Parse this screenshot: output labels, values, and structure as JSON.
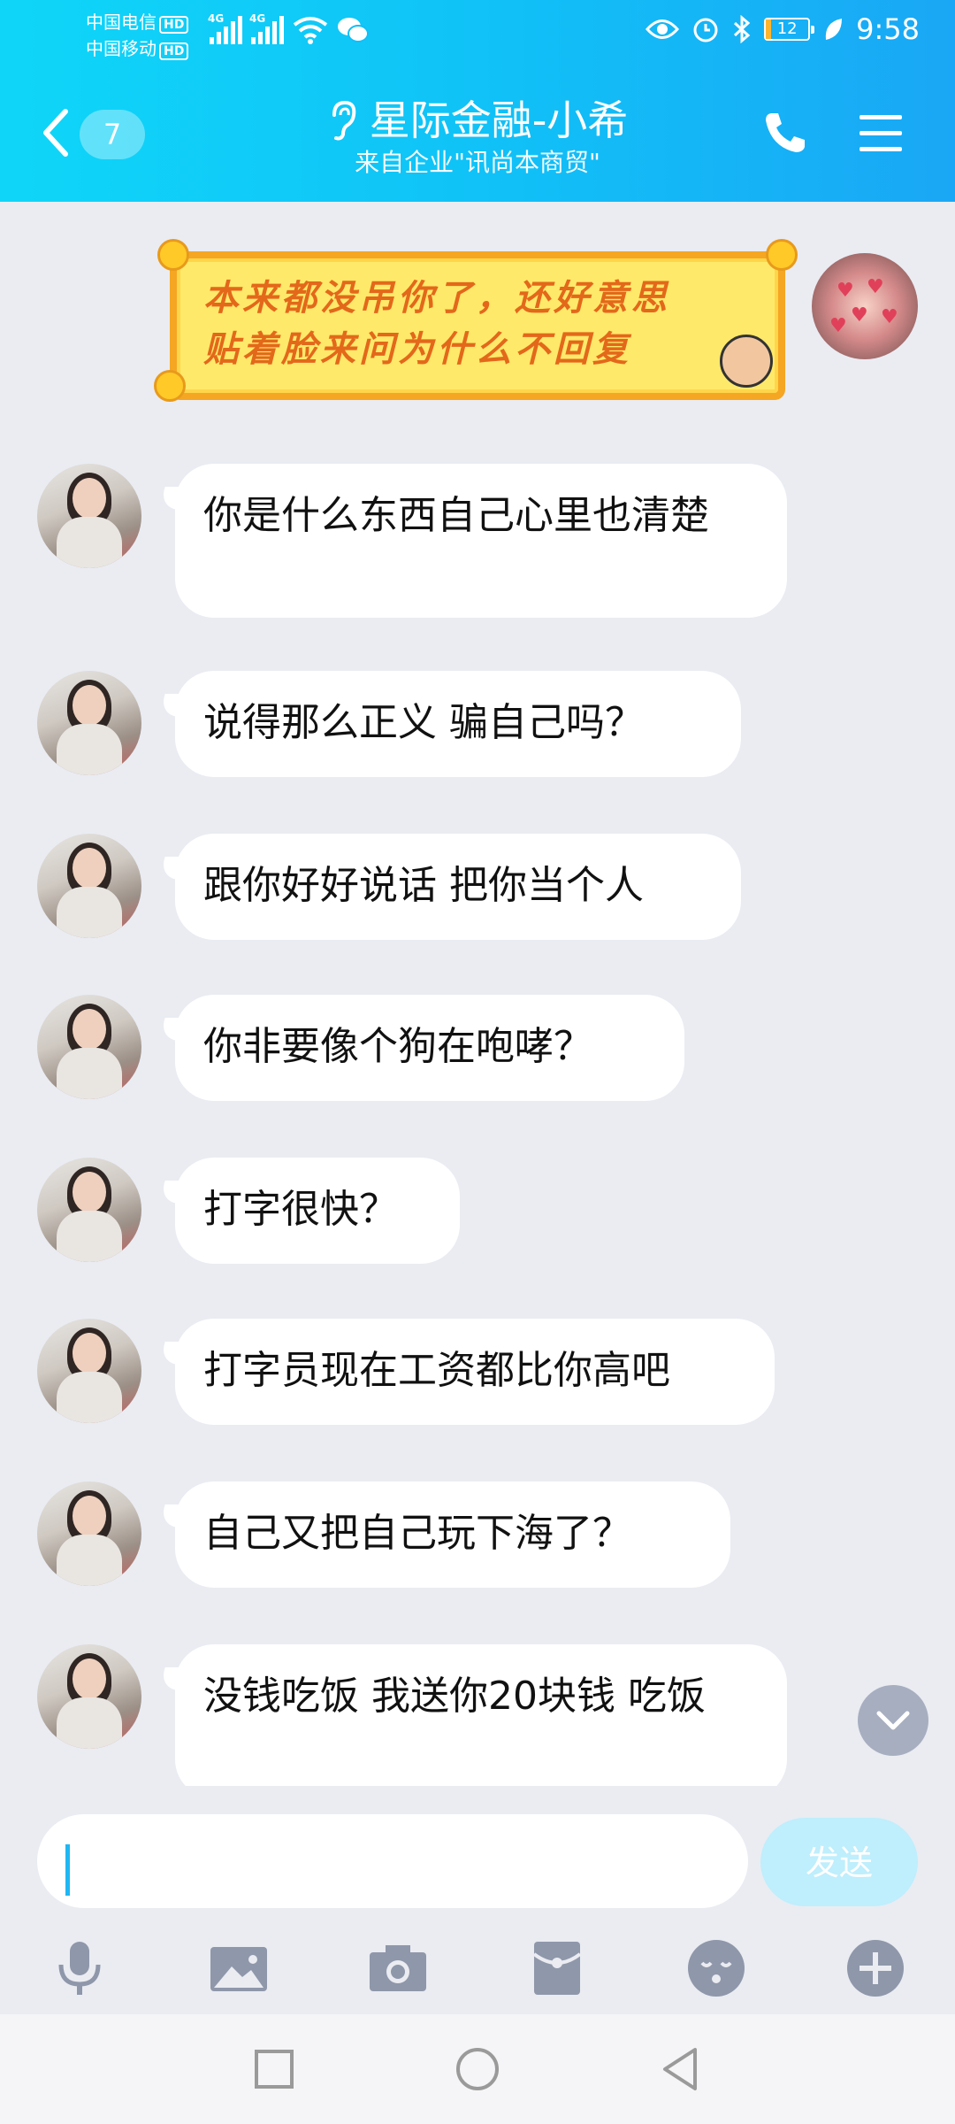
{
  "status_bar": {
    "carrier1": "中国电信",
    "carrier2": "中国移动",
    "hd": "HD",
    "network": "4G",
    "battery": "12",
    "time": "9:58"
  },
  "header": {
    "unread_count": "7",
    "title": "星际金融-小希",
    "subtitle": "来自企业\"讯尚本商贸\""
  },
  "sticker": {
    "line1": "本来都没吊你了，还好意思",
    "line2": "贴着脸来问为什么不回复"
  },
  "messages": [
    {
      "text": "你是什么东西自己心里也清楚"
    },
    {
      "text": "说得那么正义 骗自己吗？"
    },
    {
      "text": "跟你好好说话 把你当个人"
    },
    {
      "text": "你非要像个狗在咆哮？"
    },
    {
      "text": "打字很快？"
    },
    {
      "text": "打字员现在工资都比你高吧"
    },
    {
      "text": "自己又把自己玩下海了？"
    },
    {
      "text": "没钱吃饭 我送你20块钱 吃饭"
    }
  ],
  "input": {
    "value": "",
    "send_label": "发送"
  },
  "icons": {
    "back": "chevron-left-icon",
    "ear": "ear-icon",
    "phone": "phone-icon",
    "menu": "menu-icon",
    "scroll_down": "chevron-down-icon",
    "tools": [
      "microphone-icon",
      "image-icon",
      "camera-icon",
      "red-packet-icon",
      "emoji-icon",
      "plus-icon"
    ],
    "nav": [
      "recent-apps-icon",
      "home-icon",
      "back-triangle-icon"
    ]
  },
  "colors": {
    "header_start": "#0fd6f8",
    "header_end": "#1aa7f5",
    "background": "#eaecf2",
    "send_button": "#bfeefc",
    "caret": "#1fb7f2"
  }
}
